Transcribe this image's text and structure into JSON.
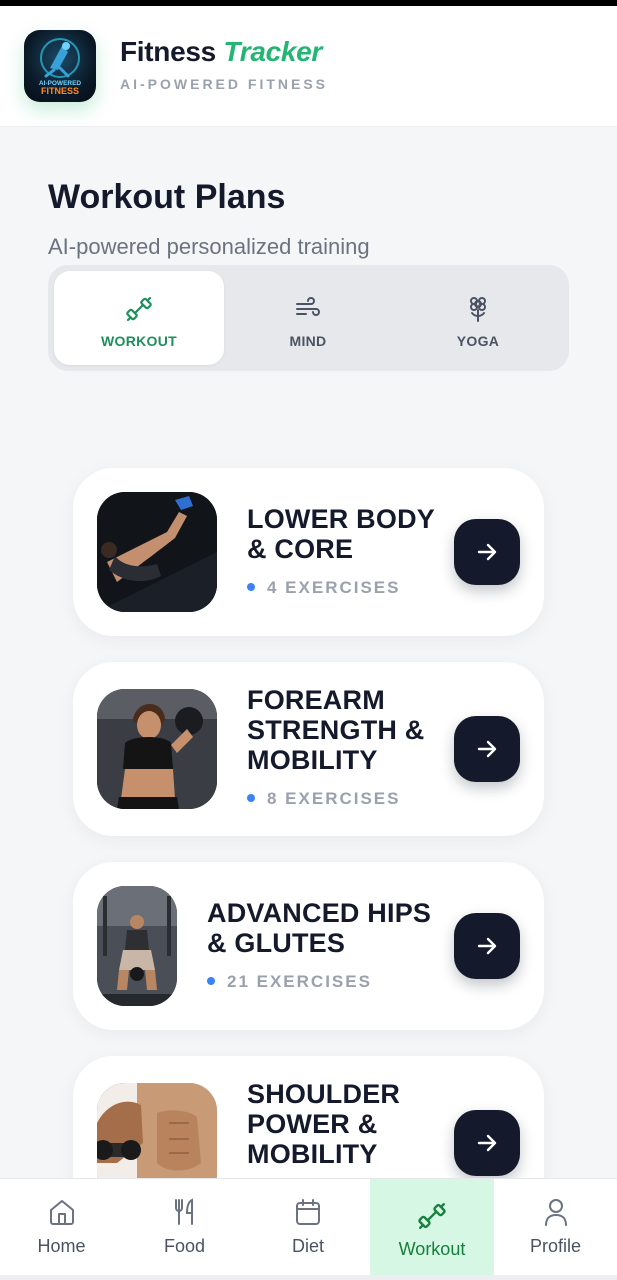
{
  "app": {
    "title_main": "Fitness ",
    "title_accent": "Tracker",
    "subtitle": "AI-POWERED FITNESS",
    "logo_text_top": "AI-POWERED",
    "logo_text_bottom": "FITNESS",
    "accent_color": "#22b573"
  },
  "page": {
    "title": "Workout Plans",
    "subtitle": "AI-powered personalized training"
  },
  "segments": [
    {
      "label": "WORKOUT",
      "icon": "dumbbell-icon",
      "active": true
    },
    {
      "label": "MIND",
      "icon": "wind-icon",
      "active": false
    },
    {
      "label": "YOGA",
      "icon": "flower-icon",
      "active": false
    }
  ],
  "plans": [
    {
      "title_lines": [
        "LOWER BODY",
        "& CORE"
      ],
      "exercises": "4 EXERCISES",
      "image": "person doing leg raises in dark gym"
    },
    {
      "title_lines": [
        "FOREARM",
        "STRENGTH &",
        "MOBILITY"
      ],
      "exercises": "8 EXERCISES",
      "image": "woman lifting dumbbell in gym"
    },
    {
      "title_lines": [
        "ADVANCED HIPS",
        "& GLUTES"
      ],
      "exercises": "21 EXERCISES",
      "image": "woman doing kettlebell squat in gym"
    },
    {
      "title_lines": [
        "SHOULDER",
        "POWER &",
        "MOBILITY"
      ],
      "exercises": "",
      "image": "man lifting dumbbell"
    }
  ],
  "nav": [
    {
      "label": "Home",
      "icon": "home-icon",
      "active": false
    },
    {
      "label": "Food",
      "icon": "fork-knife-icon",
      "active": false
    },
    {
      "label": "Diet",
      "icon": "calendar-icon",
      "active": false
    },
    {
      "label": "Workout",
      "icon": "dumbbell-icon",
      "active": true
    },
    {
      "label": "Profile",
      "icon": "user-icon",
      "active": false
    }
  ],
  "colors": {
    "dark": "#141a2b",
    "active_green": "#1d8f5c",
    "nav_active_bg": "#d6f7e3",
    "dot_blue": "#3b82f6"
  }
}
